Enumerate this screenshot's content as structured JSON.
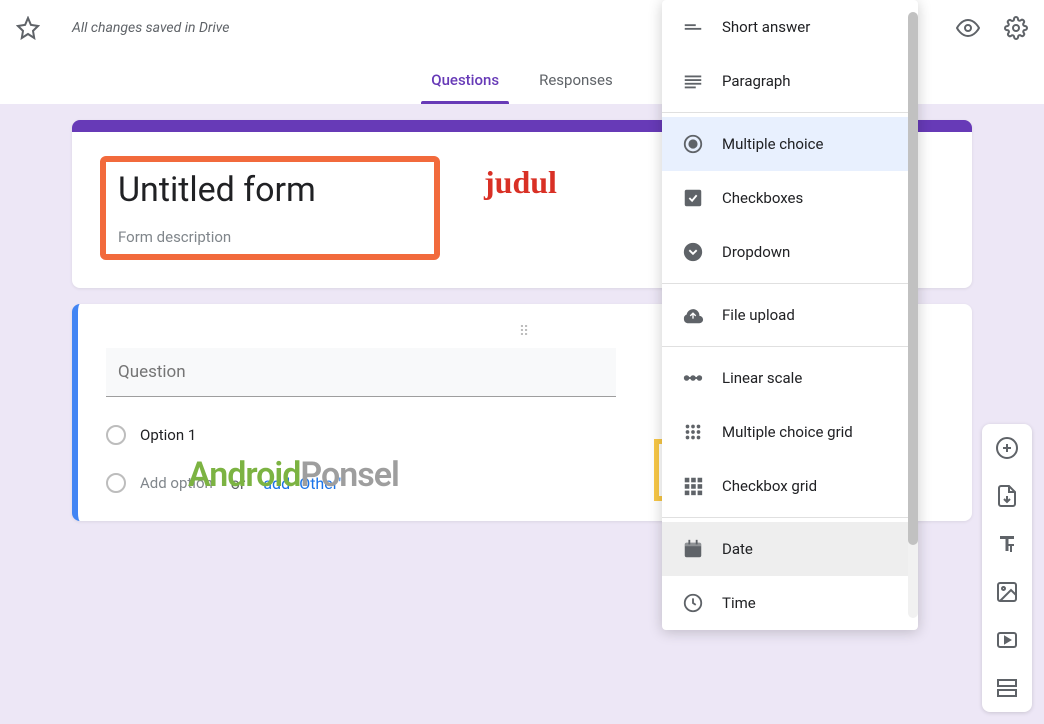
{
  "topbar": {
    "save_status": "All changes saved in Drive"
  },
  "tabs": {
    "questions": "Questions",
    "responses": "Responses"
  },
  "form": {
    "title": "Untitled form",
    "description": "Form description",
    "judul_annotation": "judul"
  },
  "question": {
    "placeholder": "Question",
    "option1": "Option 1",
    "add_option": "Add option",
    "or_text": "or",
    "add_other": "add \"Other\""
  },
  "watermark": {
    "part1": "Android",
    "part2": "Ponsel"
  },
  "dropdown": {
    "short_answer": "Short answer",
    "paragraph": "Paragraph",
    "multiple_choice": "Multiple choice",
    "checkboxes": "Checkboxes",
    "dropdown": "Dropdown",
    "file_upload": "File upload",
    "linear_scale": "Linear scale",
    "mc_grid": "Multiple choice grid",
    "cb_grid": "Checkbox grid",
    "date": "Date",
    "time": "Time"
  }
}
